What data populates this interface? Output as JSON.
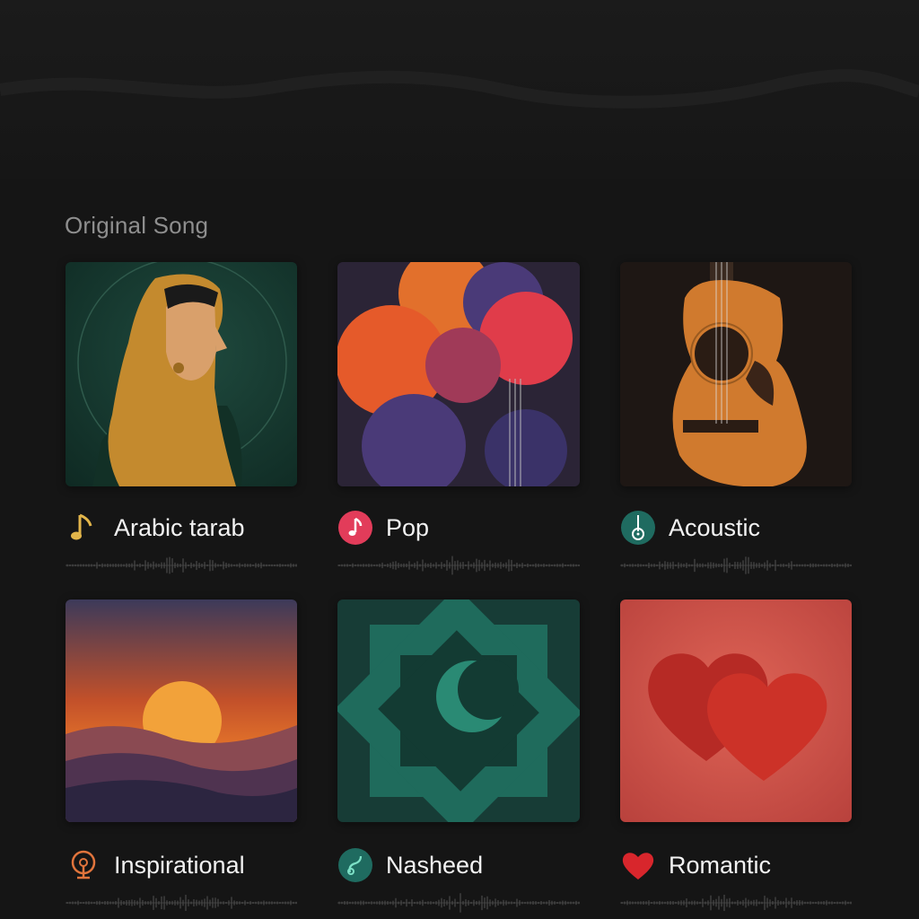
{
  "section": {
    "title": "Original Song"
  },
  "cards": [
    {
      "label": "Arabic tarab",
      "icon": "music-note-icon",
      "art": "woman-in-headscarf-artwork"
    },
    {
      "label": "Pop",
      "icon": "music-note-badge-icon",
      "art": "colorful-circles-artwork"
    },
    {
      "label": "Acoustic",
      "icon": "guitar-badge-icon",
      "art": "acoustic-guitar-artwork"
    },
    {
      "label": "Inspirational",
      "icon": "microphone-icon",
      "art": "sunset-mountains-artwork"
    },
    {
      "label": "Nasheed",
      "icon": "nasheed-badge-icon",
      "art": "crescent-star-artwork"
    },
    {
      "label": "Romantic",
      "icon": "heart-icon",
      "art": "two-hearts-artwork"
    }
  ],
  "colors": {
    "background": "#151515",
    "title": "#8e8e8e",
    "label": "#f2f2f2",
    "pop_badge": "#e23c5a",
    "teal_badge": "#1f6b60",
    "tarab_note": "#e2b54a",
    "inspirational_icon": "#e0743c",
    "heart": "#d8262c"
  }
}
